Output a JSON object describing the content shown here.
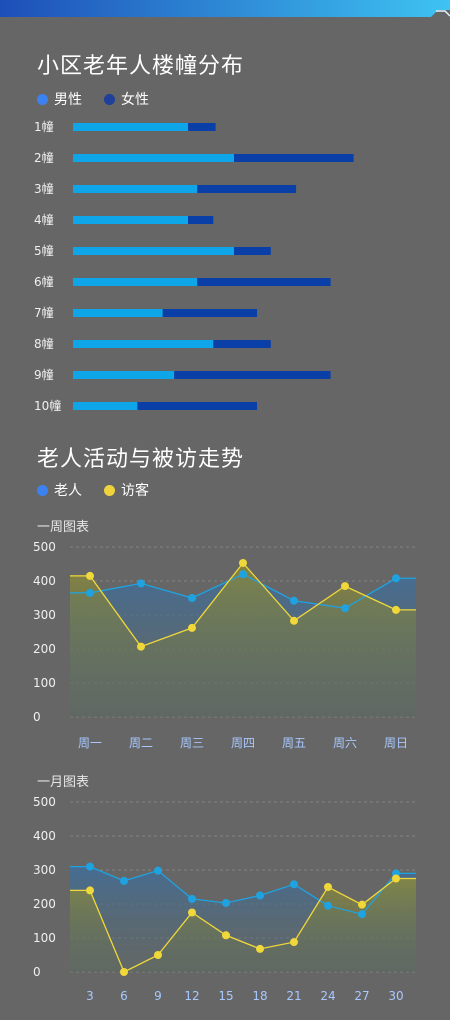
{
  "bar_section": {
    "title": "小区老年人楼幢分布",
    "legend": [
      {
        "label": "男性",
        "color": "#3b82f0"
      },
      {
        "label": "女性",
        "color": "#1e3f9a"
      }
    ]
  },
  "trend_section": {
    "title": "老人活动与被访走势",
    "legend": [
      {
        "label": "老人",
        "color": "#3b82f0"
      },
      {
        "label": "访客",
        "color": "#f0d23c"
      }
    ]
  },
  "colors": {
    "male_bar": "#0ea5e9",
    "female_bar": "#0b3fa8",
    "elder_line": "#1fa3e0",
    "visitor_line": "#f0d83a",
    "axis_text": "#f0f0f0",
    "x_tick_text": "#a8c8ff"
  },
  "chart_data": [
    {
      "type": "bar",
      "stacked": true,
      "orientation": "horizontal",
      "categories": [
        "1幢",
        "2幢",
        "3幢",
        "4幢",
        "5幢",
        "6幢",
        "7幢",
        "8幢",
        "9幢",
        "10幢"
      ],
      "series": [
        {
          "name": "男性",
          "values": [
            50,
            70,
            54,
            50,
            70,
            54,
            39,
            61,
            44,
            28
          ]
        },
        {
          "name": "女性",
          "values": [
            12,
            52,
            43,
            11,
            16,
            58,
            41,
            25,
            68,
            52
          ]
        }
      ],
      "xlim": [
        0,
        150
      ],
      "grid": false,
      "legend_position": "top-left"
    },
    {
      "type": "line",
      "title": "一周图表",
      "categories": [
        "周一",
        "周二",
        "周三",
        "周四",
        "周五",
        "周六",
        "周日"
      ],
      "series": [
        {
          "name": "老人",
          "values": [
            365,
            393,
            350,
            420,
            342,
            320,
            408
          ]
        },
        {
          "name": "访客",
          "values": [
            415,
            207,
            262,
            453,
            283,
            385,
            315
          ]
        }
      ],
      "ylim": [
        0,
        500
      ],
      "yticks": [
        0,
        100,
        200,
        300,
        400,
        500
      ],
      "grid": true
    },
    {
      "type": "line",
      "title": "一月图表",
      "categories": [
        "3",
        "6",
        "9",
        "12",
        "15",
        "18",
        "21",
        "24",
        "27",
        "30"
      ],
      "series": [
        {
          "name": "老人",
          "values": [
            310,
            268,
            298,
            215,
            203,
            225,
            258,
            195,
            170,
            290
          ]
        },
        {
          "name": "访客",
          "values": [
            240,
            0,
            50,
            175,
            108,
            68,
            88,
            250,
            198,
            275
          ]
        }
      ],
      "ylim": [
        0,
        500
      ],
      "yticks": [
        0,
        100,
        200,
        300,
        400,
        500
      ],
      "grid": true
    }
  ]
}
